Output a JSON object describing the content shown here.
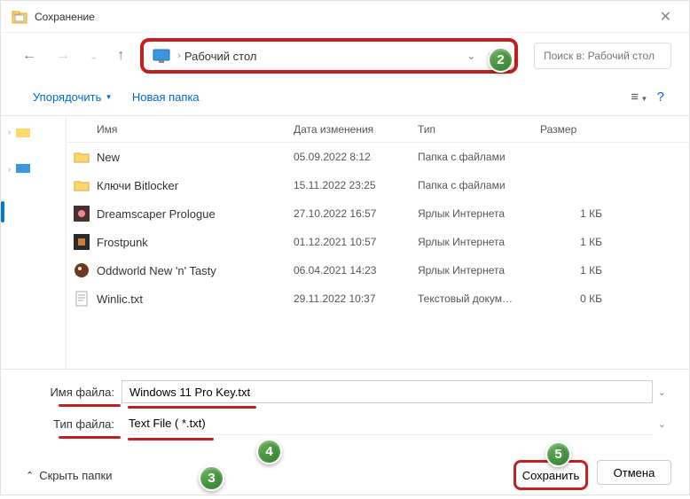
{
  "title": "Сохранение",
  "breadcrumb": "Рабочий стол",
  "search_placeholder": "Поиск в: Рабочий стол",
  "toolbar": {
    "organize": "Упорядочить",
    "newfolder": "Новая папка"
  },
  "headers": {
    "name": "Имя",
    "date": "Дата изменения",
    "type": "Тип",
    "size": "Размер"
  },
  "files": [
    {
      "name": "New",
      "date": "05.09.2022 8:12",
      "type": "Папка с файлами",
      "size": "",
      "icon": "folder"
    },
    {
      "name": "Ключи Bitlocker",
      "date": "15.11.2022 23:25",
      "type": "Папка с файлами",
      "size": "",
      "icon": "folder"
    },
    {
      "name": "Dreamscaper Prologue",
      "date": "27.10.2022 16:57",
      "type": "Ярлык Интернета",
      "size": "1 КБ",
      "icon": "app1"
    },
    {
      "name": "Frostpunk",
      "date": "01.12.2021 10:57",
      "type": "Ярлык Интернета",
      "size": "1 КБ",
      "icon": "app2"
    },
    {
      "name": "Oddworld New 'n' Tasty",
      "date": "06.04.2021 14:23",
      "type": "Ярлык Интернета",
      "size": "1 КБ",
      "icon": "app3"
    },
    {
      "name": "Winlic.txt",
      "date": "29.11.2022 10:37",
      "type": "Текстовый докум…",
      "size": "0 КБ",
      "icon": "txt"
    }
  ],
  "fields": {
    "filename_label": "Имя файла:",
    "filename_value": "Windows 11 Pro Key.txt",
    "filetype_label": "Тип файла:",
    "filetype_value": "Text File  ( *.txt)"
  },
  "footer": {
    "hide": "Скрыть папки",
    "save": "Сохранить",
    "cancel": "Отмена"
  },
  "badges": {
    "b2": "2",
    "b3": "3",
    "b4": "4",
    "b5": "5"
  }
}
